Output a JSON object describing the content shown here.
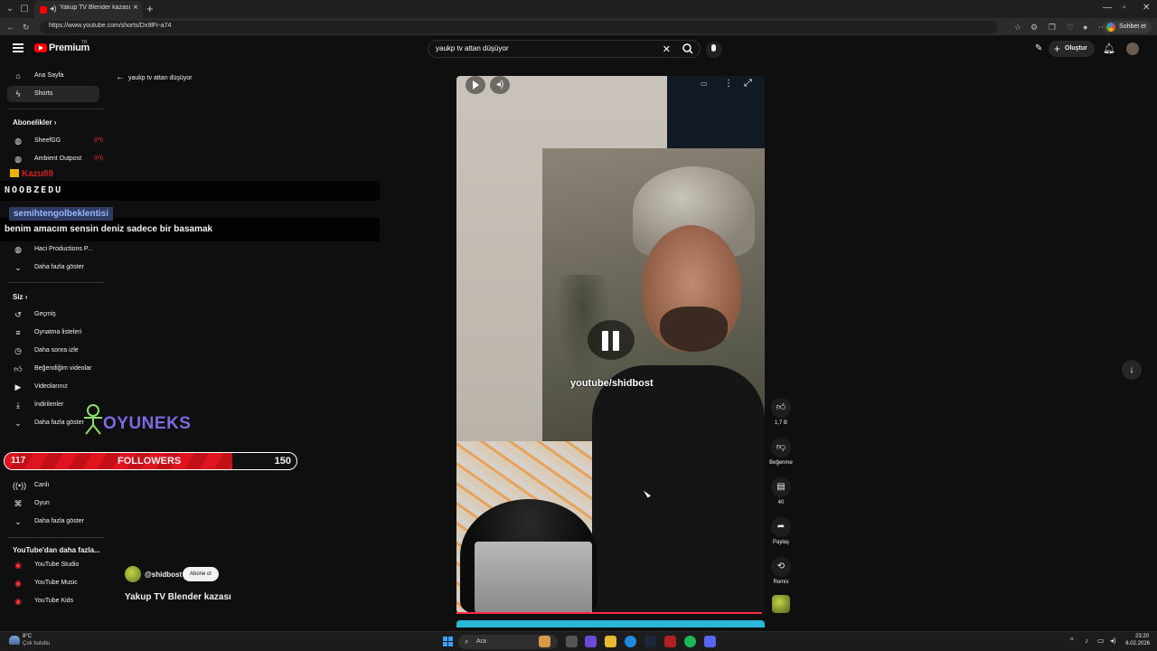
{
  "browser": {
    "tab_title": "Yakup TV Blender kazası - YouTube",
    "url": "https://www.youtube.com/shorts/Dx9lFr-a74",
    "chat_label": "Sohbet et"
  },
  "header": {
    "logo_text": "Premium",
    "logo_tm": "TR",
    "search_value": "yaukp tv attan düşüyor",
    "create_label": "Oluştur"
  },
  "sidebar": {
    "home": "Ana Sayfa",
    "shorts": "Shorts",
    "subs_header": "Abonelikler",
    "subs": [
      {
        "label": "SheefGG"
      },
      {
        "label": "Ambient Outpost"
      },
      {
        "label": "Haci Productions P..."
      }
    ],
    "show_more": "Daha fazla göster",
    "you_header": "Siz",
    "you_items": [
      {
        "label": "Geçmiş"
      },
      {
        "label": "Oynatma listeleri"
      },
      {
        "label": "Daha sonra izle"
      },
      {
        "label": "Beğendiğim videolar"
      },
      {
        "label": "Videolarınız"
      },
      {
        "label": "İndirilenler"
      },
      {
        "label": "Daha fazla göster"
      }
    ],
    "explore_items": [
      {
        "label": "Canlı"
      },
      {
        "label": "Oyun"
      },
      {
        "label": "Daha fazla göster"
      }
    ],
    "more_header": "YouTube'dan daha fazla...",
    "more_items": [
      {
        "label": "YouTube Studio"
      },
      {
        "label": "YouTube Music"
      },
      {
        "label": "YouTube Kids"
      }
    ]
  },
  "overlay": {
    "top_user": "Kazu89",
    "streamer": "NOOBZEDU",
    "chat_user": "semihtengolbeklentisi",
    "chat_msg": "benim amacım sensin deniz sadece bir basamak",
    "sponsor": "OYUNEKS",
    "followers_current": "117",
    "followers_label": "FOLLOWERS",
    "followers_goal": "150",
    "followers_progress": 0.78
  },
  "back_link": "yaukp tv attan düşüyor",
  "video": {
    "watermark": "youtube/shidbost"
  },
  "channel": {
    "handle": "@shidbost",
    "subscribe": "Abone ol",
    "title": "Yakup TV Blender kazası"
  },
  "actions": {
    "likes": "1,7 B",
    "dislike": "Beğenme",
    "comments": "40",
    "share": "Paylaş",
    "remix": "Remix"
  },
  "taskbar": {
    "weather_temp": "8°C",
    "weather_desc": "Çok bulutlu",
    "search": "Ara",
    "time": "23:20",
    "date": "6.02.2026"
  },
  "colors": {
    "accent": "#ff0000",
    "background": "#0f0f0f",
    "followers_bar": "#e0141e"
  }
}
